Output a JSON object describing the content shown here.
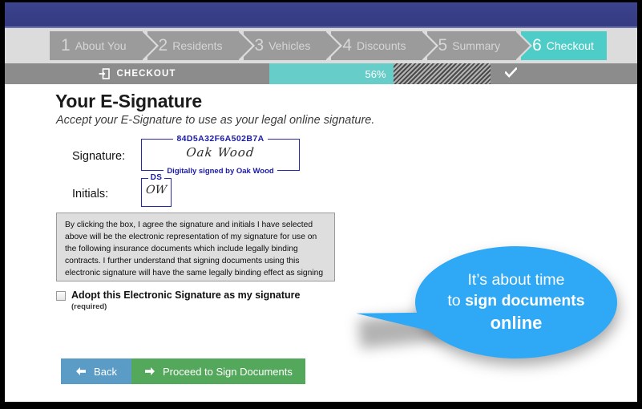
{
  "steps": {
    "items": [
      {
        "num": "1",
        "label": "About You",
        "active": false
      },
      {
        "num": "2",
        "label": "Residents",
        "active": false
      },
      {
        "num": "3",
        "label": "Vehicles",
        "active": false
      },
      {
        "num": "4",
        "label": "Discounts",
        "active": false
      },
      {
        "num": "5",
        "label": "Summary",
        "active": false
      },
      {
        "num": "6",
        "label": "Checkout",
        "active": true
      }
    ]
  },
  "progress": {
    "stage_label": "CHECKOUT",
    "stage_icon": "sign-in-arrow-icon",
    "percent_label": "56%",
    "percent_value": 56,
    "complete_icon": "checkmark-icon",
    "fill_color": "#66cdc9",
    "bar_color": "#8c8c8c"
  },
  "page": {
    "title": "Your E-Signature",
    "subtitle": "Accept your E-Signature to use as your legal online signature.",
    "signature": {
      "label": "Signature:",
      "hash": "84D5A32F6A502B7A",
      "cursive": "Oak  Wood",
      "signed_by": "Digitally signed by Oak  Wood",
      "ink_color": "#1a1aaa"
    },
    "initials": {
      "label": "Initials:",
      "hash": "DS",
      "cursive": "OW"
    },
    "agreement_text": "By clicking the box, I agree the signature and initials I have selected above will be the electronic representation of my signature for use on the following insurance documents which include legally binding contracts. I further understand that signing documents using this electronic signature will have the same legally binding effect as signing my signature using pen and paper.",
    "adopt": {
      "label": "Adopt this Electronic Signature as my signature",
      "required_note": "(required)",
      "checked": false
    },
    "buttons": {
      "back": {
        "label": "Back",
        "icon": "arrow-left-icon",
        "color": "#5b9cc6"
      },
      "proceed": {
        "label": "Proceed to Sign Documents",
        "icon": "arrow-right-icon",
        "color": "#54a85c"
      }
    }
  },
  "callout": {
    "line1": "It’s about time",
    "line2_prefix": "to ",
    "line2_bold": "sign documents",
    "line3": "online",
    "color": "#2fa8f5"
  }
}
